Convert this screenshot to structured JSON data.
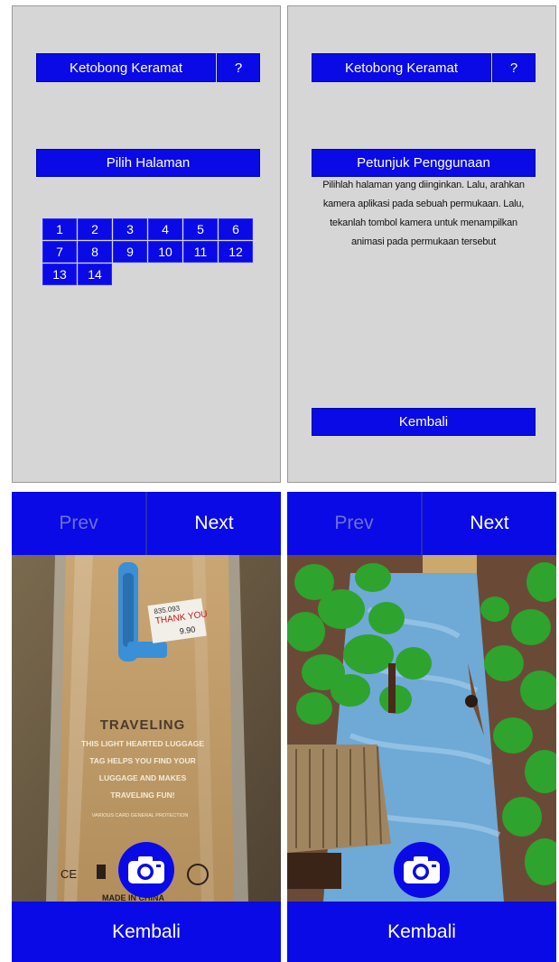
{
  "menu_screen": {
    "title_button": "Ketobong Keramat",
    "help_button": "?",
    "section_button": "Pilih Halaman",
    "page_numbers": [
      "1",
      "2",
      "3",
      "4",
      "5",
      "6",
      "7",
      "8",
      "9",
      "10",
      "11",
      "12",
      "13",
      "14"
    ]
  },
  "help_screen": {
    "title_button": "Ketobong Keramat",
    "help_button": "?",
    "section_button": "Petunjuk Penggunaan",
    "instructions": "Pilihlah halaman yang diinginkan. Lalu, arahkan kamera aplikasi pada sebuah permukaan. Lalu, tekanlah tombol kamera untuk menampilkan animasi pada permukaan tersebut",
    "back_button": "Kembali"
  },
  "camera_screen_tag": {
    "prev_button": "Prev",
    "next_button": "Next",
    "back_button": "Kembali",
    "camera_icon": "camera-icon",
    "feed": {
      "tag_title": "TRAVELING",
      "tag_lines": [
        "THIS LIGHT HEARTED LUGGAGE",
        "TAG HELPS YOU FIND YOUR",
        "LUGGAGE AND MAKES",
        "TRAVELING FUN!"
      ],
      "tag_small": "VARIOUS CARD GENERAL PROTECTION",
      "price_sticker_top": "THANK YOU",
      "price_sticker_code": "835.093",
      "price_sticker_price": "9.90",
      "ce_mark": "CE",
      "made_in": "MADE IN CHINA"
    }
  },
  "camera_screen_ar": {
    "prev_button": "Prev",
    "next_button": "Next",
    "back_button": "Kembali",
    "camera_icon": "camera-icon"
  },
  "colors": {
    "accent_blue": "#0a0ae6",
    "panel_gray": "#d6d6d6",
    "prev_disabled": "#6f6fd8"
  }
}
